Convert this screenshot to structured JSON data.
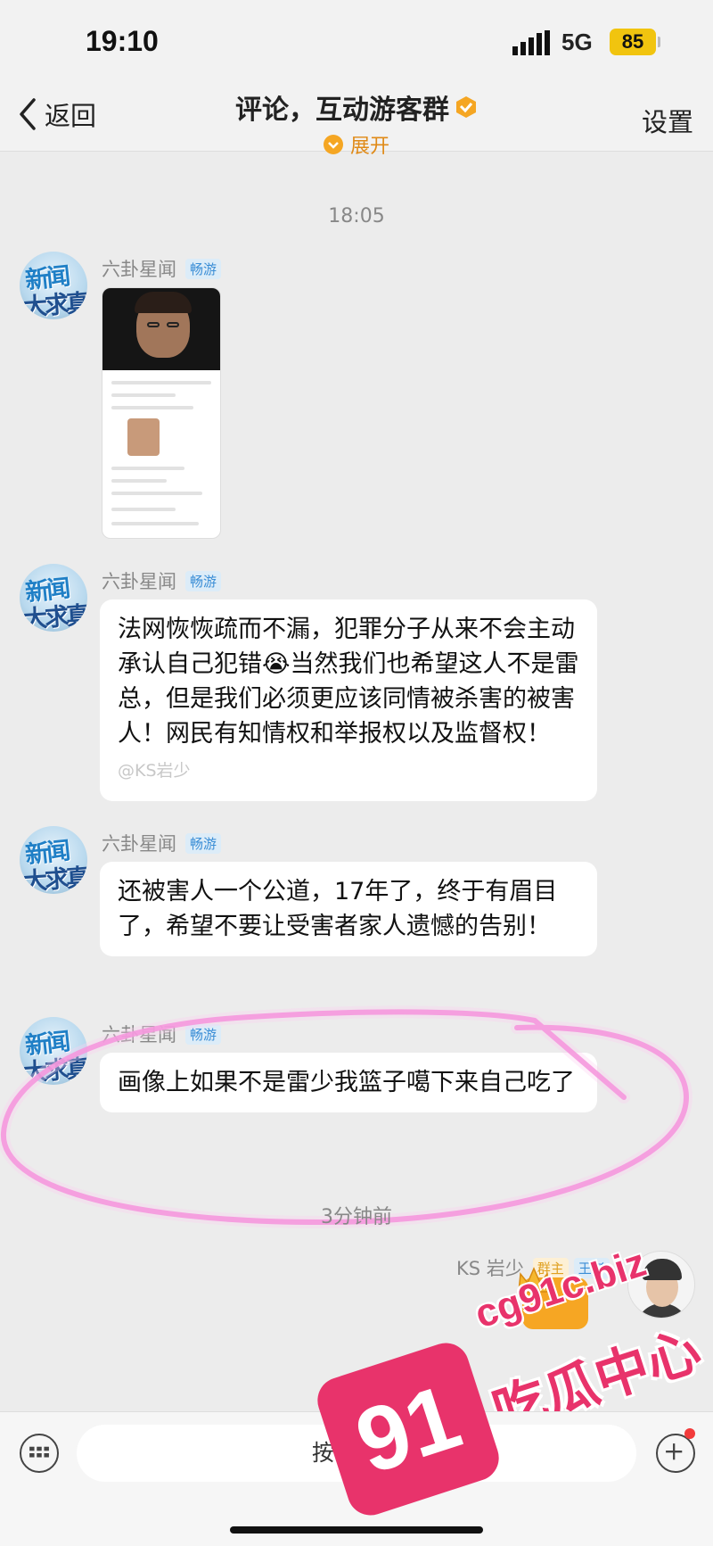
{
  "status_bar": {
    "time": "19:10",
    "network": "5G",
    "battery": "85"
  },
  "header": {
    "back_label": "返回",
    "title": "评论，互动游客群",
    "expand_label": "展开",
    "settings_label": "设置"
  },
  "colors": {
    "accent_orange": "#f5a623",
    "tag_blue": "#3b8ed6",
    "bubble_bg": "#ffffff",
    "watermark_pink": "#e8336b"
  },
  "timestamps": [
    "18:05",
    "3分钟前"
  ],
  "messages": [
    {
      "sender": "六卦星闻",
      "tag": "畅游",
      "type": "image"
    },
    {
      "sender": "六卦星闻",
      "tag": "畅游",
      "type": "text",
      "text": "法网恢恢疏而不漏，犯罪分子从来不会主动承认自己犯错😭当然我们也希望这人不是雷总，但是我们必须更应该同情被杀害的被害人！网民有知情权和举报权以及监督权！",
      "watermark": "@KS岩少"
    },
    {
      "sender": "六卦星闻",
      "tag": "畅游",
      "type": "text",
      "text": "还被害人一个公道，17年了，终于有眉目了，希望不要让受害者家人遗憾的告别！"
    },
    {
      "sender": "六卦星闻",
      "tag": "畅游",
      "type": "text",
      "text": "画像上如果不是雷少我篮子噶下来自己吃了"
    }
  ],
  "self_message": {
    "sender": "KS 岩少",
    "tag_owner": "群主",
    "tag_rank": "王者"
  },
  "avatar_logo": {
    "line1": "新闻",
    "line2": "大求真"
  },
  "watermark": {
    "number": "91",
    "url": "cg91c.biz",
    "name": "吃瓜中心"
  },
  "input": {
    "press_to_talk": "按住说话"
  }
}
